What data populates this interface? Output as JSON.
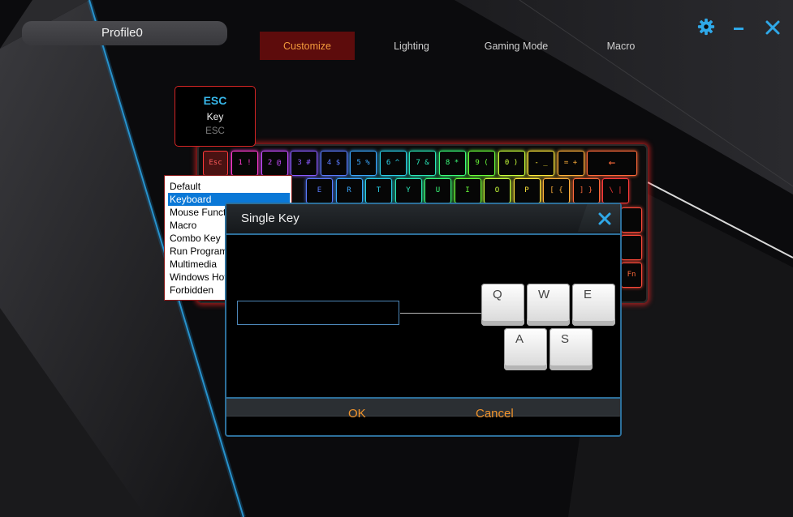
{
  "profile": {
    "name": "Profile0"
  },
  "nav": {
    "tabs": [
      {
        "label": "Customize",
        "active": true
      },
      {
        "label": "Lighting",
        "active": false
      },
      {
        "label": "Gaming Mode",
        "active": false
      },
      {
        "label": "Macro",
        "active": false
      }
    ]
  },
  "window_controls": {
    "icons": [
      "gear-icon",
      "minimize-icon",
      "close-icon"
    ],
    "accent": "#2fa8e8"
  },
  "key_info": {
    "name": "ESC",
    "type": "Key",
    "value": "ESC"
  },
  "keyboard": {
    "row1": [
      "Esc",
      "1 !",
      "2 @",
      "3 #",
      "4 $",
      "5 %",
      "6 ^",
      "7 &",
      "8 *",
      "9 (",
      "0 )",
      "- _",
      "= +",
      "←"
    ],
    "row2": [
      "E",
      "R",
      "T",
      "Y",
      "U",
      "I",
      "O",
      "P",
      "[ {",
      "] }",
      "\\ |"
    ],
    "right_edge_fn": "Fn"
  },
  "key_type_menu": {
    "items": [
      "Default",
      "Keyboard",
      "Mouse Function",
      "Macro",
      "Combo Key",
      "Run Program",
      "Multimedia",
      "Windows Hotkey",
      "Forbidden"
    ],
    "selected": "Keyboard"
  },
  "dialog": {
    "title": "Single Key",
    "input_value": "",
    "keycaps": [
      "Q",
      "W",
      "E",
      "A",
      "S"
    ],
    "ok_label": "OK",
    "cancel_label": "Cancel"
  },
  "colors": {
    "active_tab_bg": "#5d0c0c",
    "active_tab_text": "#f29a3c",
    "dialog_border": "#2d6f9a",
    "button_text": "#f0932b"
  }
}
